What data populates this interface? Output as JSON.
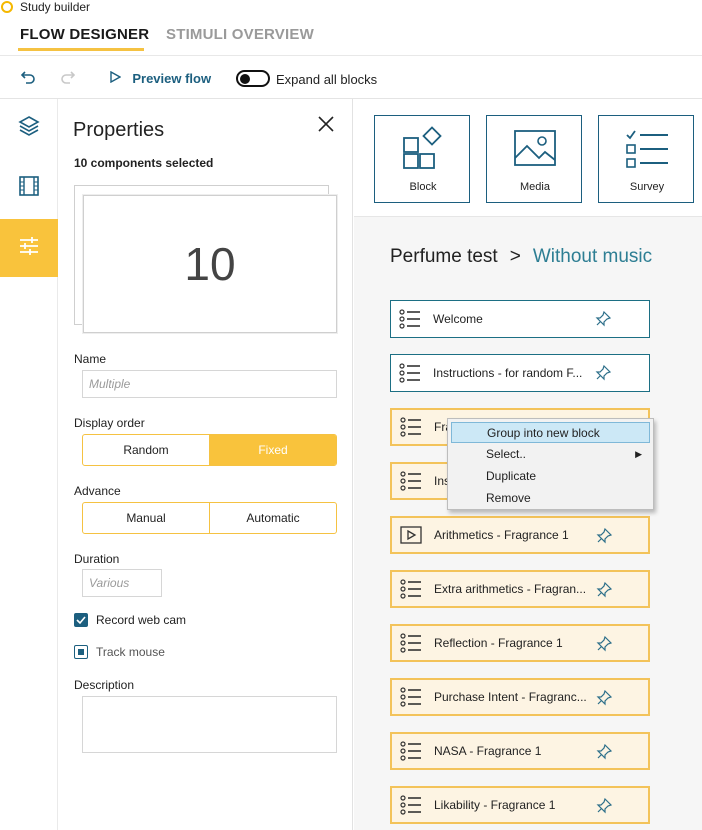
{
  "app": {
    "title": "Study builder"
  },
  "tabs": [
    {
      "label": "FLOW DESIGNER",
      "active": true
    },
    {
      "label": "STIMULI OVERVIEW",
      "active": false
    }
  ],
  "toolbar": {
    "preview_label": "Preview flow",
    "expand_label": "Expand all blocks",
    "expand_on": false
  },
  "rail": {
    "items": [
      {
        "icon": "layers-icon",
        "active": false
      },
      {
        "icon": "film-icon",
        "active": false
      },
      {
        "icon": "sliders-icon",
        "active": true
      }
    ]
  },
  "properties": {
    "title": "Properties",
    "subtitle": "10 components selected",
    "count": "10",
    "name_label": "Name",
    "name_placeholder": "Multiple",
    "display_order_label": "Display order",
    "display_order_options": [
      "Random",
      "Fixed"
    ],
    "display_order_selected": "Fixed",
    "advance_label": "Advance",
    "advance_options": [
      "Manual",
      "Automatic"
    ],
    "duration_label": "Duration",
    "duration_placeholder": "Various",
    "record_webcam_label": "Record web cam",
    "record_webcam_checked": true,
    "track_mouse_label": "Track mouse",
    "description_label": "Description"
  },
  "palette": [
    {
      "label": "Block",
      "icon": "block-icon"
    },
    {
      "label": "Media",
      "icon": "image-icon"
    },
    {
      "label": "Survey",
      "icon": "survey-icon"
    }
  ],
  "breadcrumb": {
    "parent": "Perfume test",
    "separator": ">",
    "current": "Without music"
  },
  "flow_items": [
    {
      "label": "Welcome",
      "icon": "list-icon",
      "selected": false
    },
    {
      "label": "Instructions - for random F...",
      "icon": "list-icon",
      "selected": false
    },
    {
      "label": "Fra",
      "icon": "list-icon",
      "selected": true
    },
    {
      "label": "Ins",
      "icon": "list-icon",
      "selected": true
    },
    {
      "label": "Arithmetics - Fragrance 1",
      "icon": "play-icon",
      "selected": true
    },
    {
      "label": "Extra arithmetics - Fragran...",
      "icon": "list-icon",
      "selected": true
    },
    {
      "label": "Reflection - Fragrance 1",
      "icon": "list-icon",
      "selected": true
    },
    {
      "label": "Purchase Intent - Fragranc...",
      "icon": "list-icon",
      "selected": true
    },
    {
      "label": "NASA - Fragrance 1",
      "icon": "list-icon",
      "selected": true
    },
    {
      "label": "Likability - Fragrance 1",
      "icon": "list-icon",
      "selected": true
    }
  ],
  "context_menu": [
    {
      "label": "Group into new block",
      "highlighted": true,
      "submenu": false
    },
    {
      "label": "Select..",
      "highlighted": false,
      "submenu": true
    },
    {
      "label": "Duplicate",
      "highlighted": false,
      "submenu": false
    },
    {
      "label": "Remove",
      "highlighted": false,
      "submenu": false
    }
  ],
  "colors": {
    "accent_yellow": "#f9c33c",
    "primary_teal": "#1c5f7f",
    "breadcrumb_current": "#2d7e93"
  }
}
